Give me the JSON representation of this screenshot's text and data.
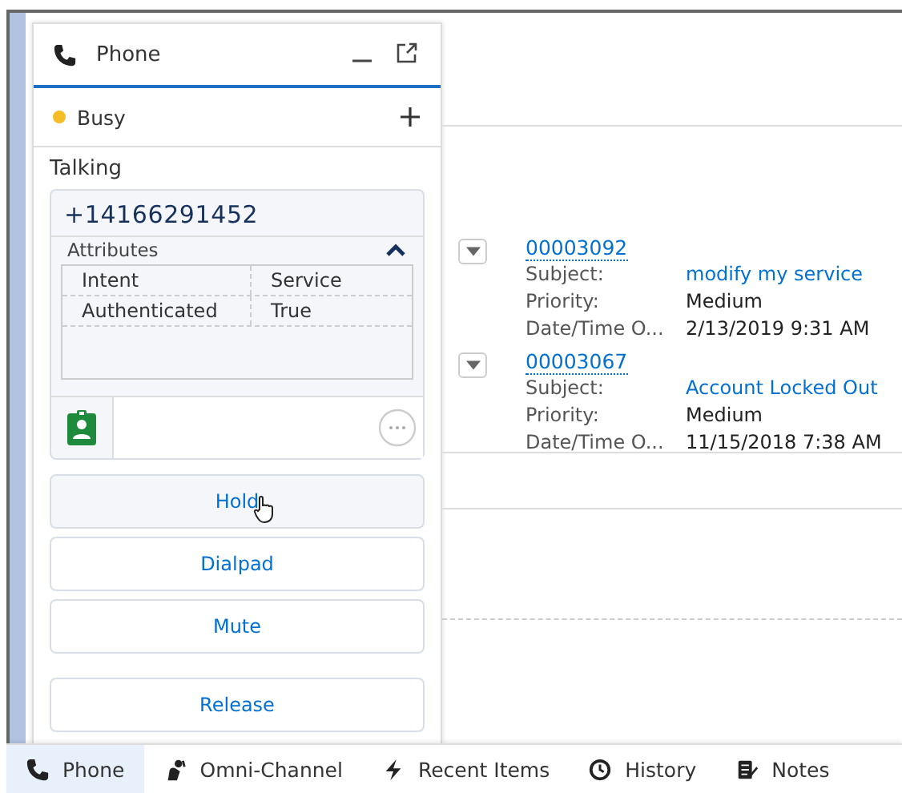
{
  "phone_panel": {
    "title": "Phone",
    "status": {
      "label": "Busy",
      "color": "#f4bc25"
    },
    "call_state": "Talking",
    "caller": {
      "number": "+14166291452",
      "attributes_title": "Attributes",
      "expanded": true,
      "attributes": [
        {
          "name": "Intent",
          "value": "Service"
        },
        {
          "name": "Authenticated",
          "value": "True"
        }
      ]
    },
    "buttons": [
      {
        "label": "Hold",
        "hovered": true
      },
      {
        "label": "Dialpad",
        "hovered": false
      },
      {
        "label": "Mute",
        "hovered": false
      }
    ],
    "release_button": "Release"
  },
  "cases": [
    {
      "number": "00003092",
      "fields": [
        {
          "label": "Subject:",
          "value": "modify my service",
          "kind": "link"
        },
        {
          "label": "Priority:",
          "value": "Medium",
          "kind": "text"
        },
        {
          "label": "Date/Time O...",
          "value": "2/13/2019 9:31 AM",
          "kind": "text"
        }
      ]
    },
    {
      "number": "00003067",
      "fields": [
        {
          "label": "Subject:",
          "value": "Account Locked Out",
          "kind": "link"
        },
        {
          "label": "Priority:",
          "value": "Medium",
          "kind": "text"
        },
        {
          "label": "Date/Time O...",
          "value": "11/15/2018 7:38 AM",
          "kind": "text"
        }
      ]
    }
  ],
  "utility_bar": [
    {
      "label": "Phone",
      "kind": "phone",
      "selected": true
    },
    {
      "label": "Omni-Channel",
      "kind": "omni",
      "selected": false
    },
    {
      "label": "Recent Items",
      "kind": "bolt",
      "selected": false
    },
    {
      "label": "History",
      "kind": "clock",
      "selected": false
    },
    {
      "label": "Notes",
      "kind": "notes",
      "selected": false
    }
  ]
}
